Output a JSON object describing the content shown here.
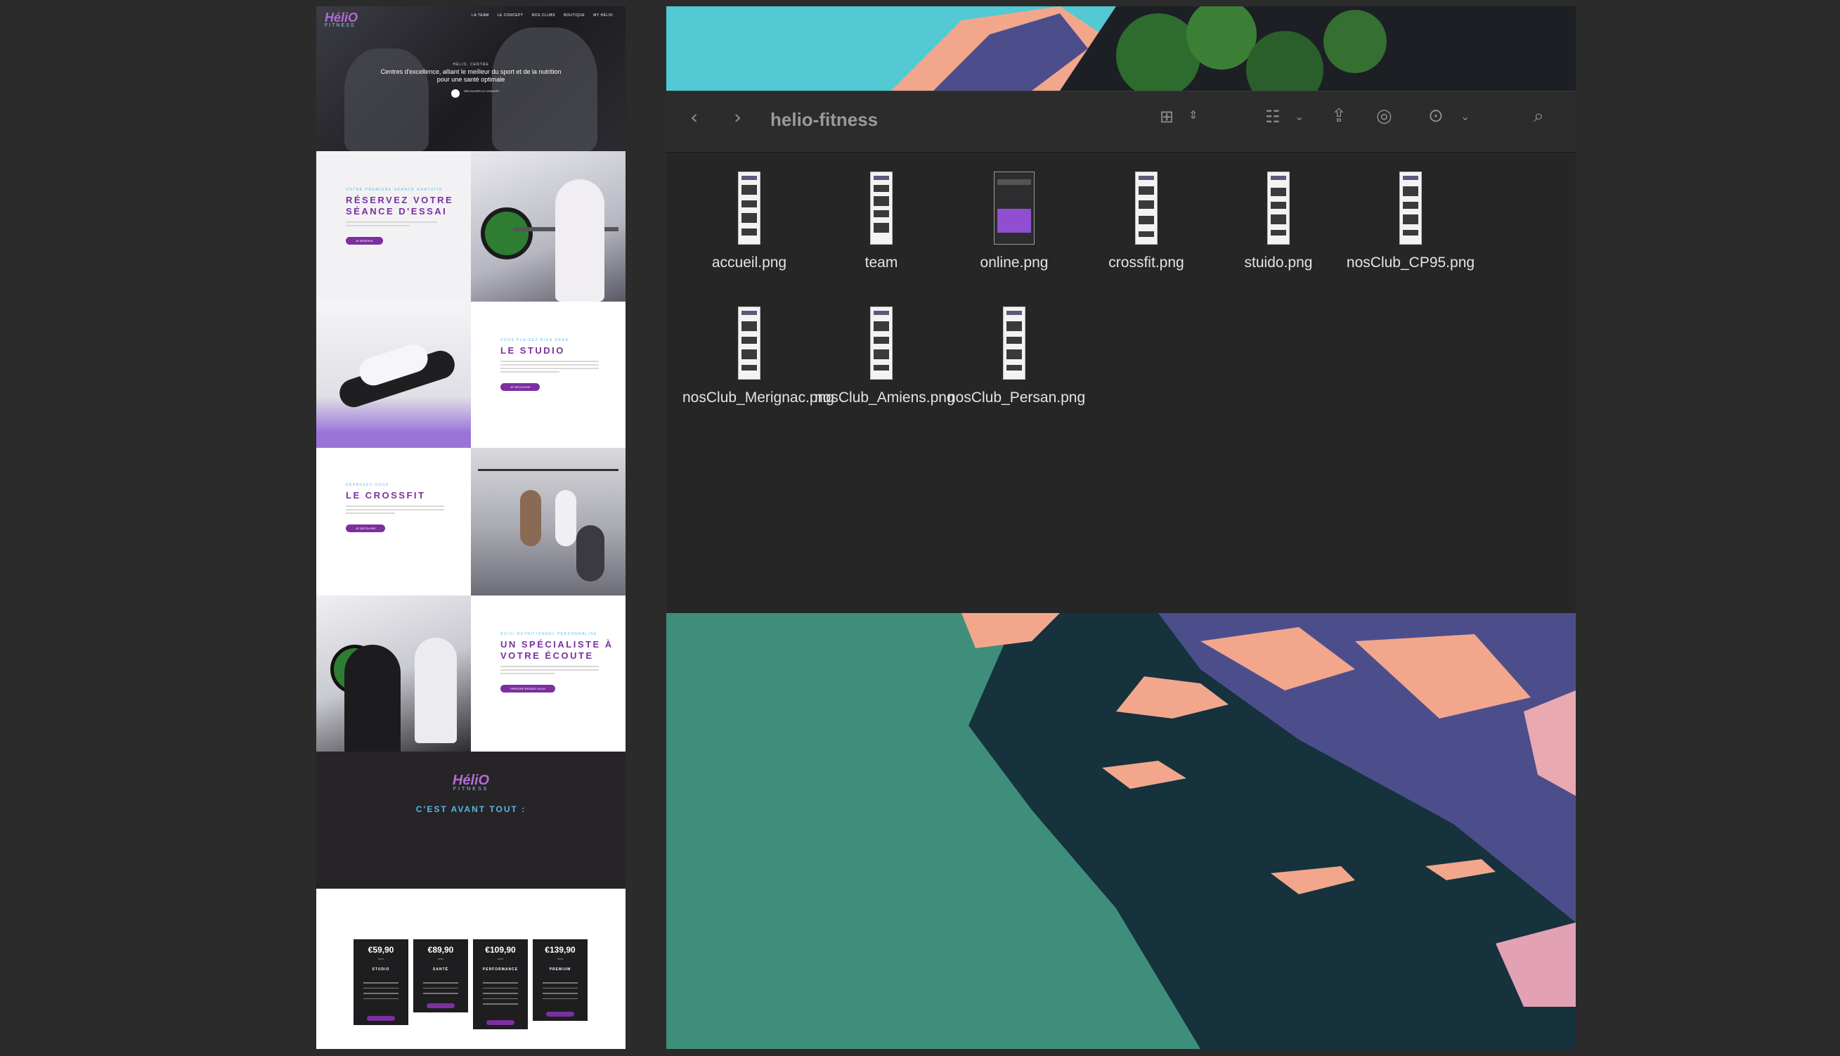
{
  "website": {
    "logo": "HéliO",
    "logo_sub": "FITNESS",
    "nav": [
      "LA TEAM",
      "LE CONCEPT",
      "NOS CLUBS",
      "BOUTIQUE",
      "MY HÉLIO"
    ],
    "hero_eyebrow": "HÉLIO, CENTRE",
    "hero_tagline": "Centres d'excellence, alliant le meilleur du sport et de la nutrition pour une santé optimale",
    "hero_scroll": "DÉCOUVRIR LE CONCEPT",
    "sections": [
      {
        "eyebrow": "VOTRE PREMIÈRE SÉANCE GRATUITE",
        "title": "RÉSERVEZ VOTRE SÉANCE D'ESSAI",
        "button": "JE RÉSERVE"
      },
      {
        "eyebrow": "VOUS PLAISEZ BIEN DANS",
        "title": "LE STUDIO",
        "button": "JE DÉCOUVRE"
      },
      {
        "eyebrow": "DÉPASSEZ-VOUS",
        "title": "LE CROSSFIT",
        "button": "JE DÉCOUVRE"
      },
      {
        "eyebrow": "SUIVI NUTRITIONNEL PERSONNALISÉ",
        "title": "UN SPÉCIALISTE À VOTRE ÉCOUTE",
        "button": "PRENDRE RENDEZ-VOUS"
      }
    ],
    "slogan": "C'EST AVANT TOUT :",
    "pricing": [
      {
        "price": "€59,90",
        "period": "/MOIS",
        "name": "STUDIO"
      },
      {
        "price": "€89,90",
        "period": "/MOIS",
        "name": "SANTÉ"
      },
      {
        "price": "€109,90",
        "period": "/MOIS",
        "name": "PERFORMANCE"
      },
      {
        "price": "€139,90",
        "period": "/MOIS",
        "name": "PREMIUM"
      }
    ]
  },
  "finder": {
    "title": "helio-fitness",
    "toolbar_icons": [
      "back-icon",
      "forward-icon",
      "icon-view-icon",
      "group-icon",
      "share-icon",
      "airdrop-icon",
      "more-icon",
      "search-icon"
    ],
    "files": [
      {
        "name": "accueil.png"
      },
      {
        "name": "team"
      },
      {
        "name": "online.png"
      },
      {
        "name": "crossfit.png"
      },
      {
        "name": "stuido.png"
      },
      {
        "name": "nosClub_CP95.png"
      },
      {
        "name": "nosClub_Merignac.png"
      },
      {
        "name": "nosClub_Amiens.png"
      },
      {
        "name": "nosClub_Persan.png"
      }
    ]
  },
  "colors": {
    "brand_purple": "#7b2fa0",
    "brand_blue": "#57b7e6",
    "finder_bg": "#262627",
    "wallpaper_teal": "#3f8e7b",
    "wallpaper_sky": "#53c9d3",
    "wallpaper_peach": "#f2a78c"
  }
}
